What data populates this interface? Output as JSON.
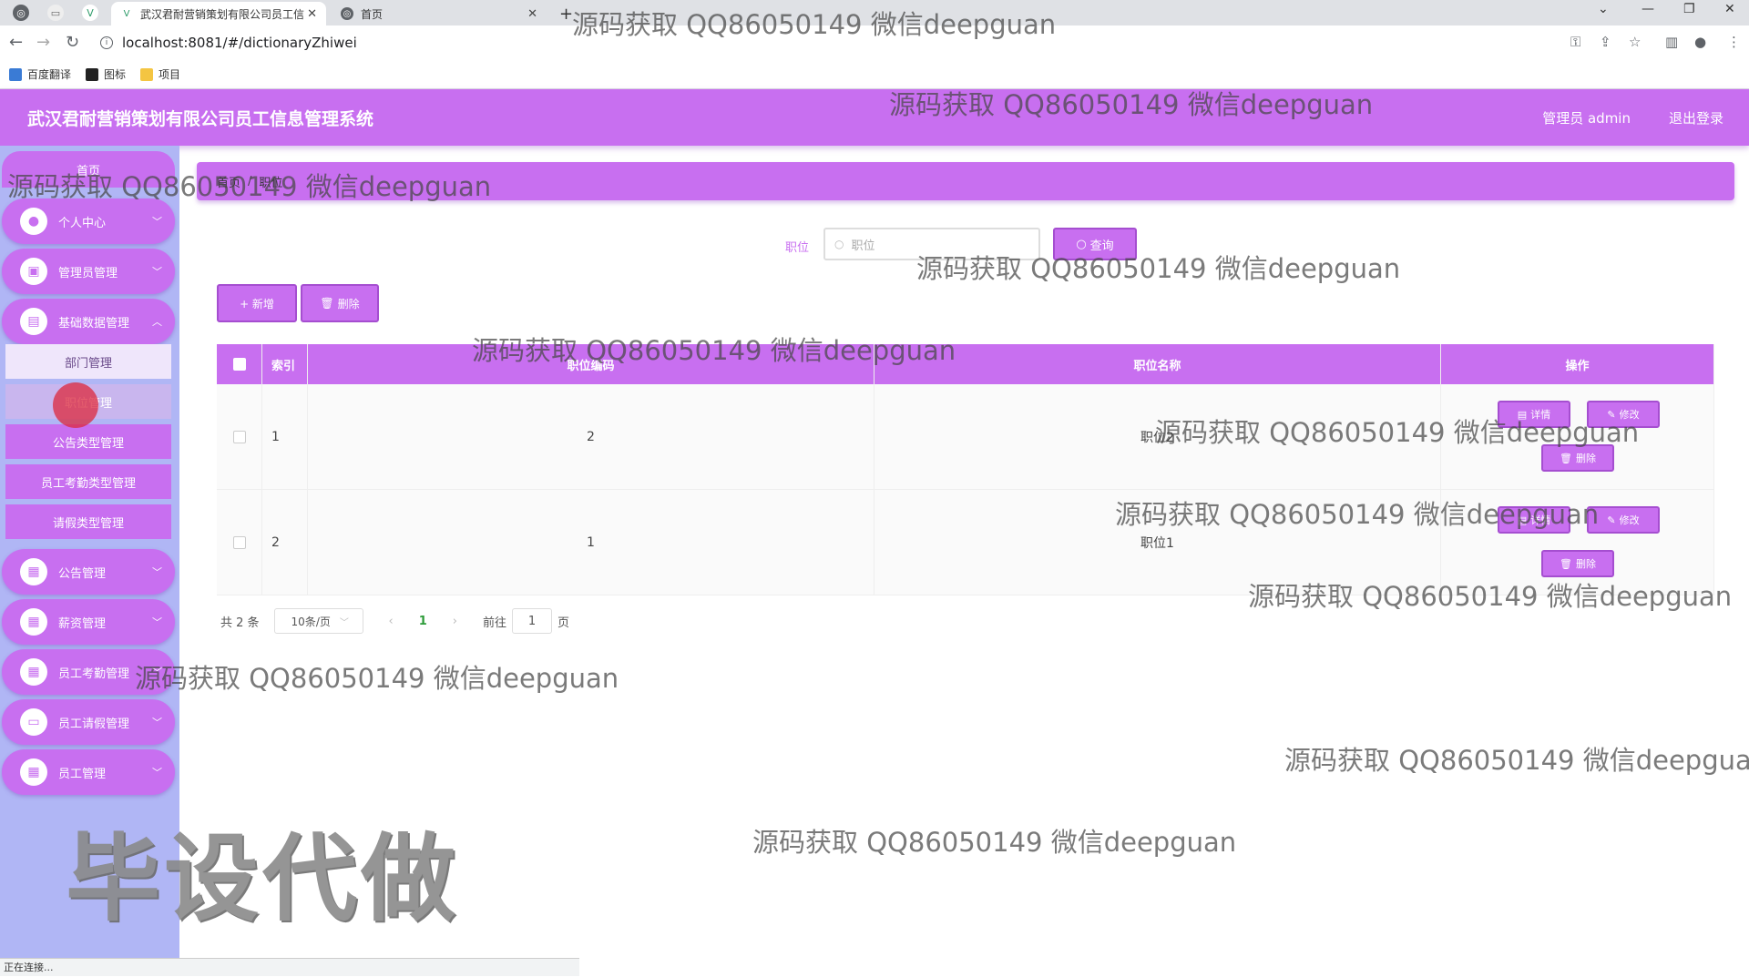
{
  "browser": {
    "tabs": [
      {
        "title": "武汉君耐营销策划有限公司员工信",
        "active": true
      },
      {
        "title": "首页",
        "active": false
      }
    ],
    "new_tab": "+",
    "url": "localhost:8081/#/dictionaryZhiwei",
    "bookmarks": [
      "百度翻译",
      "图标",
      "项目"
    ],
    "status": "正在连接..."
  },
  "app": {
    "title": "武汉君耐营销策划有限公司员工信息管理系统",
    "user": "管理员 admin",
    "logout": "退出登录"
  },
  "sidebar": {
    "home": "首页",
    "menus": [
      {
        "label": "个人中心",
        "icon": "user-icon"
      },
      {
        "label": "管理员管理",
        "icon": "admin-icon"
      },
      {
        "label": "基础数据管理",
        "icon": "clipboard-icon"
      },
      {
        "label": "公告管理",
        "icon": "grid-icon"
      },
      {
        "label": "薪资管理",
        "icon": "grid-icon"
      },
      {
        "label": "员工考勤管理",
        "icon": "grid-icon"
      },
      {
        "label": "员工请假管理",
        "icon": "chat-icon"
      },
      {
        "label": "员工管理",
        "icon": "grid-icon"
      }
    ],
    "submenu": [
      "部门管理",
      "职位管理",
      "公告类型管理",
      "员工考勤类型管理",
      "请假类型管理"
    ]
  },
  "breadcrumb": {
    "home": "首页",
    "sep": "/",
    "current": "职位"
  },
  "search": {
    "label": "职位",
    "placeholder": "职位",
    "button": "查询"
  },
  "actions": {
    "add": "+ 新增",
    "delete": "删除"
  },
  "table": {
    "headers": [
      "索引",
      "职位编码",
      "职位名称",
      "操作"
    ],
    "rows": [
      {
        "index": "1",
        "code": "2",
        "name": "职位2"
      },
      {
        "index": "2",
        "code": "1",
        "name": "职位1"
      }
    ],
    "row_buttons": {
      "detail": "详情",
      "edit": "修改",
      "delete": "删除"
    }
  },
  "pagination": {
    "total": "共 2 条",
    "page_size": "10条/页",
    "current": "1",
    "goto_label": "前往",
    "goto_value": "1",
    "goto_suffix": "页"
  },
  "watermark": {
    "text": "源码获取 QQ86050149 微信deepguan",
    "big": "毕设代做"
  },
  "colors": {
    "accent": "#c86ff0",
    "sidebar": "#b0b6f5"
  }
}
